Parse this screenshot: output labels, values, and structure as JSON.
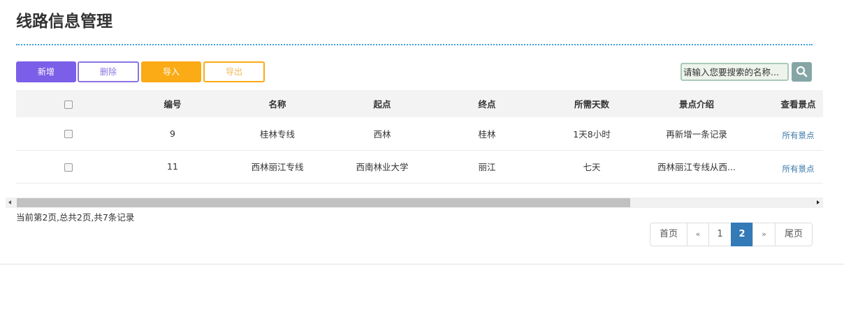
{
  "page": {
    "title": "线路信息管理"
  },
  "toolbar": {
    "add_label": "新增",
    "delete_label": "删除",
    "import_label": "导入",
    "export_label": "导出"
  },
  "search": {
    "placeholder": "请输入您要搜索的名称..."
  },
  "table": {
    "headers": [
      "编号",
      "名称",
      "起点",
      "终点",
      "所需天数",
      "景点介绍",
      "查看景点"
    ],
    "rows": [
      {
        "id": "9",
        "name": "桂林专线",
        "start": "西林",
        "end": "桂林",
        "days": "1天8小时",
        "intro": "再新增一条记录",
        "link": "所有景点"
      },
      {
        "id": "11",
        "name": "西林丽江专线",
        "start": "西南林业大学",
        "end": "丽江",
        "days": "七天",
        "intro": "西林丽江专线从西...",
        "link": "所有景点"
      }
    ]
  },
  "pagination": {
    "info": "当前第2页,总共2页,共7条记录",
    "first": "首页",
    "prev": "«",
    "pages": [
      "1",
      "2"
    ],
    "current": "2",
    "next": "»",
    "last": "尾页"
  },
  "colors": {
    "add_button": "#7b5fe8",
    "import_button": "#fbab15",
    "active_page": "#337ab7",
    "link": "#3b78a8"
  },
  "icons": {
    "search": "search-icon"
  }
}
